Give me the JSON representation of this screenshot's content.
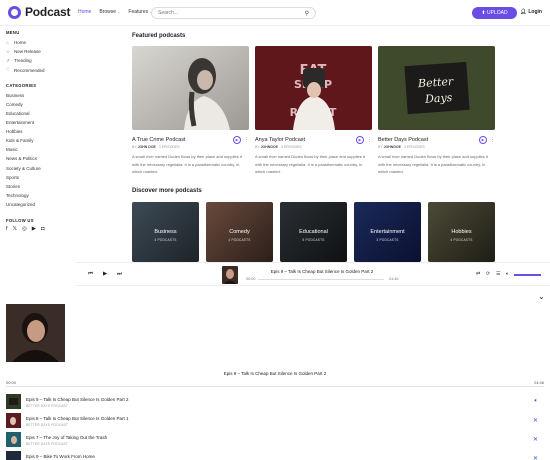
{
  "header": {
    "logo_text": "Podcast",
    "nav": [
      {
        "label": "Home",
        "active": true
      },
      {
        "label": "Browse",
        "caret": "⌄"
      },
      {
        "label": "Features",
        "caret": "⌄"
      }
    ],
    "search_placeholder": "Search...",
    "upload_label": "⬆ UPLOAD",
    "login_label": "Login"
  },
  "sidebar": {
    "menu_title": "MENU",
    "menu": [
      {
        "label": "Home",
        "icon": "home-icon",
        "glyph": "⌂"
      },
      {
        "label": "New Release",
        "icon": "release-icon",
        "glyph": "☆"
      },
      {
        "label": "Trending",
        "icon": "trending-icon",
        "glyph": "↗"
      },
      {
        "label": "Recommended",
        "icon": "recommended-icon",
        "glyph": "♡"
      }
    ],
    "categories_title": "CATEGORIES",
    "categories": [
      "Business",
      "Comedy",
      "Educational",
      "Entertainment",
      "Hobbies",
      "Kids & Family",
      "Music",
      "News & Politics",
      "Society & Culture",
      "Sports",
      "Stories",
      "Technology",
      "Uncategorized"
    ],
    "follow_title": "FOLLOW US",
    "social": [
      "f",
      "𝕏",
      "◎",
      "▶",
      "◘"
    ]
  },
  "featured": {
    "title": "Featured podcasts",
    "cards": [
      {
        "title": "A True Crime Podcast",
        "by": "BY",
        "author": "JOHN DOE",
        "episodes": "3 EPISODES",
        "desc": "A small river named Duden flows by their place and supplies it with the necessary regelialia. It is a paradisematic country, in which roasted."
      },
      {
        "title": "Anya Taylor Podcast",
        "by": "BY",
        "author": "JOHNDOE",
        "episodes": "3 EPISODES",
        "desc": "A small river named Duden flows by their place and supplies it with the necessary regelialia. It is a paradisematic country, in which roasted."
      },
      {
        "title": "Better Days Podcast",
        "by": "BY",
        "author": "JOHNDOE",
        "episodes": "3 EPISODES",
        "desc": "A small river named Duden flows by their place and supplies it with the necessary regelialia. It is a paradisematic country, in which roasted."
      }
    ]
  },
  "discover": {
    "title": "Discover more podcasts",
    "tiles": [
      {
        "label": "Business",
        "count": "4 PODCASTS"
      },
      {
        "label": "Comedy",
        "count": "4 PODCASTS"
      },
      {
        "label": "Educational",
        "count": "5 PODCASTS"
      },
      {
        "label": "Entertainment",
        "count": "3 PODCASTS"
      },
      {
        "label": "Hobbies",
        "count": "4 PODCASTS"
      }
    ]
  },
  "player": {
    "title": "Epis 9 – Talk Is Cheap But Silence Is Golden Part 2",
    "current": "00:00",
    "duration": "24:46",
    "volume_fraction": 0.75
  },
  "now_playing": {
    "title": "Epis 9 – Talk Is Cheap But Silence Is Golden Part 2",
    "current": "00:00",
    "duration": "24:46"
  },
  "queue": [
    {
      "title": "Epis 9 – Talk Is Cheap But Silence Is Golden Part 2",
      "sub": "BETTER DAYS PODCAST",
      "icon": "volume-icon",
      "glyph": "🔈︎"
    },
    {
      "title": "Epis 8 – Talk Is Cheap But Silence Is Golden Part 1",
      "sub": "BETTER DAYS PODCAST",
      "icon": "remove-icon",
      "glyph": "✕"
    },
    {
      "title": "Epis 7 – The Joy of Taking Out the Trash",
      "sub": "BETTER DAYS PODCAST",
      "icon": "remove-icon",
      "glyph": "✕"
    },
    {
      "title": "Epis 9 – Bike To Work From Home",
      "sub": "",
      "icon": "remove-icon",
      "glyph": "✕"
    }
  ],
  "colors": {
    "accent": "#6b4de6",
    "queue_icon": "#3b55c9"
  }
}
